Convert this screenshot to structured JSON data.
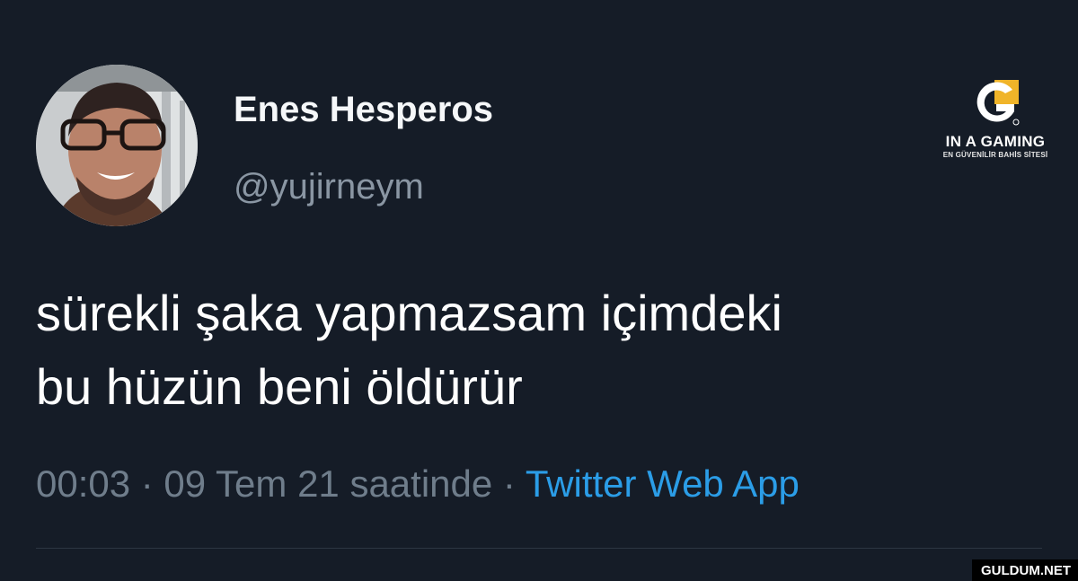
{
  "tweet": {
    "author": {
      "display_name": "Enes Hesperos",
      "handle": "@yujirneym"
    },
    "text_lines": [
      "sürekli şaka yapmazsam içimdeki",
      "bu hüzün beni öldürür"
    ],
    "timestamp": "00:03 · 09 Tem 21 saatinde",
    "separator": " · ",
    "source": "Twitter Web App"
  },
  "brand": {
    "name": "IN A GAMING",
    "tagline": "EN GÜVENİLİR BAHİS SİTESİ",
    "accent_color": "#f0b429"
  },
  "watermark": "GULDUM.NET",
  "colors": {
    "background": "#151c27",
    "link": "#2b9de7",
    "secondary_text": "#8a96a3"
  }
}
